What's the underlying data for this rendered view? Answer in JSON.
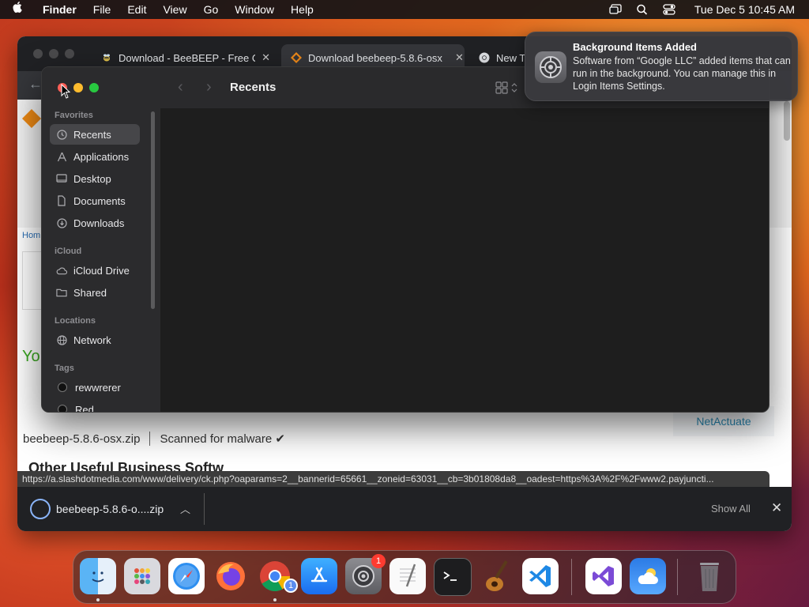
{
  "menubar": {
    "app_name": "Finder",
    "menus": [
      "File",
      "Edit",
      "View",
      "Go",
      "Window",
      "Help"
    ],
    "clock": "Tue Dec 5  10:45 AM",
    "icons": [
      "screen-mirroring-icon",
      "spotlight-search-icon",
      "control-center-icon"
    ]
  },
  "browser": {
    "tabs": [
      {
        "title": "Download - BeeBEEP - Free O",
        "favicon": "bee-icon",
        "active": false
      },
      {
        "title": "Download beebeep-5.8.6-osx",
        "favicon": "beebeep-logo-icon",
        "active": true
      },
      {
        "title": "New T",
        "favicon": "chrome-icon",
        "active": false
      }
    ],
    "page": {
      "breadcrumb_partial": "Hom",
      "headline_partial": "Yo",
      "download_filename": "beebeep-5.8.6-osx.zip",
      "scan_status": "Scanned for malware ✔",
      "sponsor": "NetActuate",
      "section_title_partial": "Other Useful Business Softw"
    },
    "status_url": "https://a.slashdotmedia.com/www/delivery/ck.php?oaparams=2__bannerid=65661__zoneid=63031__cb=3b01808da8__oadest=https%3A%2F%2Fwww2.payjuncti...",
    "download_bar": {
      "item_name": "beebeep-5.8.6-o....zip",
      "show_all": "Show All"
    }
  },
  "finder": {
    "title": "Recents",
    "sections": [
      {
        "heading": "Favorites",
        "items": [
          {
            "label": "Recents",
            "icon": "clock-icon",
            "selected": true
          },
          {
            "label": "Applications",
            "icon": "applications-icon",
            "selected": false
          },
          {
            "label": "Desktop",
            "icon": "desktop-icon",
            "selected": false
          },
          {
            "label": "Documents",
            "icon": "document-icon",
            "selected": false
          },
          {
            "label": "Downloads",
            "icon": "download-icon",
            "selected": false
          }
        ]
      },
      {
        "heading": "iCloud",
        "items": [
          {
            "label": "iCloud Drive",
            "icon": "cloud-icon",
            "selected": false
          },
          {
            "label": "Shared",
            "icon": "shared-folder-icon",
            "selected": false
          }
        ]
      },
      {
        "heading": "Locations",
        "items": [
          {
            "label": "Network",
            "icon": "globe-icon",
            "selected": false
          }
        ]
      },
      {
        "heading": "Tags",
        "items": [
          {
            "label": "rewwrerer",
            "icon": "tag-dot-icon",
            "selected": false
          },
          {
            "label": "Red",
            "icon": "tag-dot-icon",
            "selected": false
          }
        ]
      }
    ]
  },
  "notification": {
    "title": "Background Items Added",
    "body": "Software from “Google LLC” added items that can run in the background. You can manage this in Login Items Settings.",
    "icon": "system-settings-gear-icon"
  },
  "dock": {
    "apps": [
      "Finder",
      "Launchpad",
      "Safari",
      "Firefox",
      "Google Chrome",
      "App Store",
      "System Settings",
      "TextEdit",
      "Terminal",
      "GarageBand",
      "Visual Studio Code",
      "Visual Studio",
      "Weather",
      "Trash"
    ],
    "chrome_badge": "1",
    "settings_badge": "1"
  }
}
